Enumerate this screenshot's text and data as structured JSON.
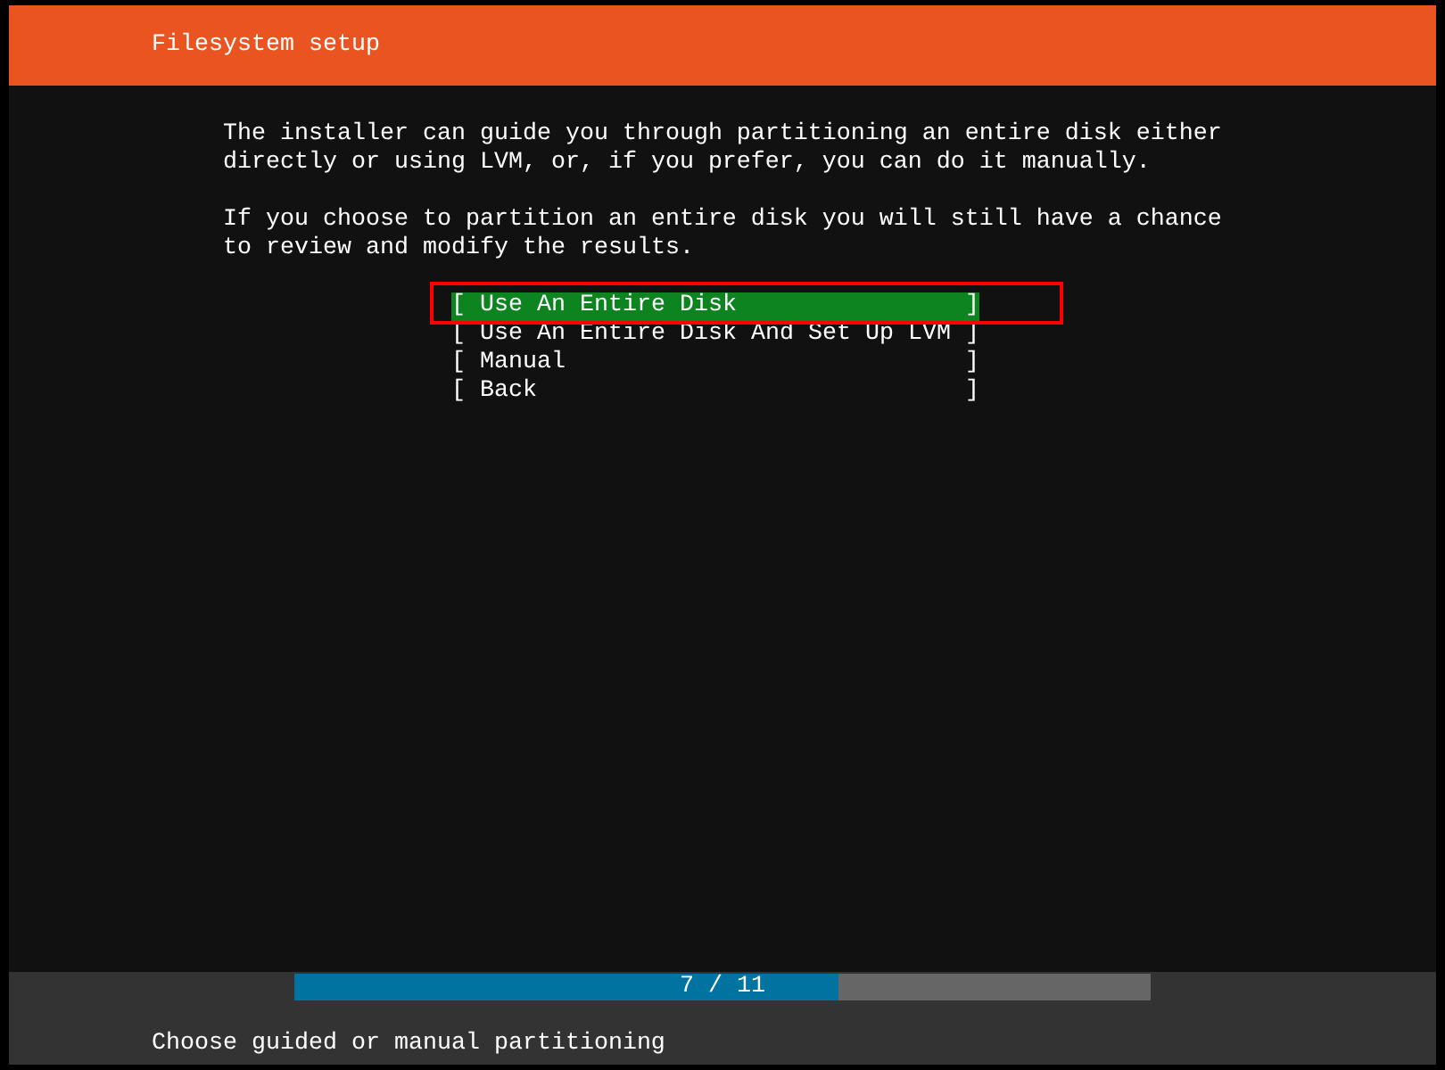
{
  "header": {
    "title": "Filesystem setup"
  },
  "paragraphs": [
    "The installer can guide you through partitioning an entire disk either directly or using LVM, or, if you prefer, you can do it manually.",
    "If you choose to partition an entire disk you will still have a chance to review and modify the results."
  ],
  "menu": [
    {
      "open": "[",
      "label": "Use An Entire Disk",
      "close": "]",
      "selected": true,
      "highlighted": true
    },
    {
      "open": "[",
      "label": "Use An Entire Disk And Set Up LVM",
      "close": "]",
      "selected": false,
      "highlighted": false
    },
    {
      "open": "[",
      "label": "Manual",
      "close": "]",
      "selected": false,
      "highlighted": false
    },
    {
      "open": "[",
      "label": "Back",
      "close": "]",
      "selected": false,
      "highlighted": false
    }
  ],
  "progress": {
    "level": 0.636,
    "label": "7 / 11"
  },
  "status_bar": "Choose guided or manual partitioning"
}
